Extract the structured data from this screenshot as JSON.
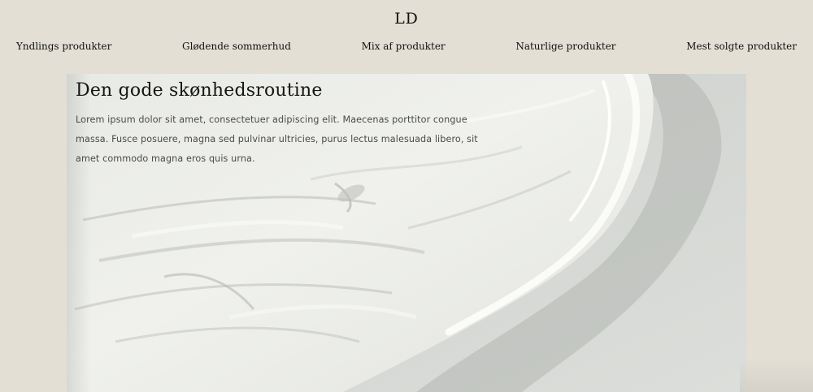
{
  "site": {
    "logo": "LD"
  },
  "nav": {
    "items": [
      {
        "label": "Yndlings produkter"
      },
      {
        "label": "Glødende sommerhud"
      },
      {
        "label": "Mix af produkter"
      },
      {
        "label": "Naturlige produkter"
      },
      {
        "label": "Mest solgte produkter"
      }
    ]
  },
  "hero": {
    "title": "Den gode skønhedsroutine",
    "body": "Lorem ipsum dolor sit amet, consectetuer adipiscing elit. Maecenas porttitor congue massa. Fusce posuere, magna sed pulvinar ultricies, purus lectus malesuada libero, sit amet commodo magna eros quis urna.",
    "image": "cream-texture-image"
  },
  "colors": {
    "page_background": "#e3dfd5",
    "hero_background": "#d9dcd8",
    "cream": "#eceee9",
    "text": "#1a1a1a"
  }
}
